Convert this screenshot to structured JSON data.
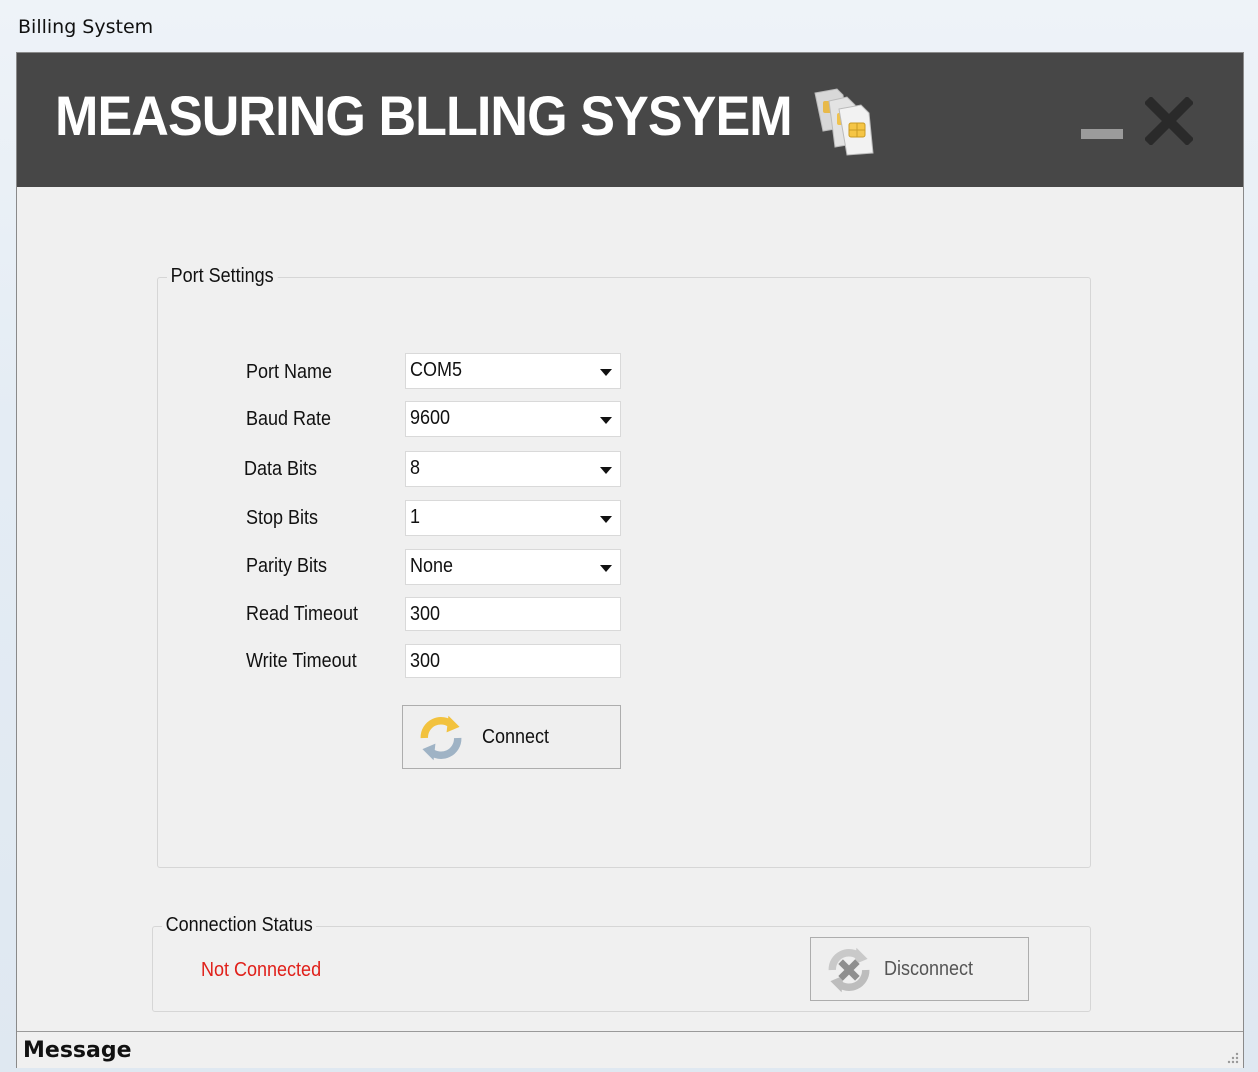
{
  "outer_window": {
    "title": "Billing System"
  },
  "header": {
    "title": "MEASURING BLLING SYSYEM",
    "icon": "sim-card-icon",
    "background": "#474747"
  },
  "port_settings": {
    "legend": "Port Settings",
    "fields": [
      {
        "label": "Port Name",
        "value": "COM5",
        "type": "dropdown"
      },
      {
        "label": "Baud Rate",
        "value": "9600",
        "type": "dropdown"
      },
      {
        "label": "Data Bits",
        "value": "8",
        "type": "dropdown"
      },
      {
        "label": "Stop Bits",
        "value": "1",
        "type": "dropdown"
      },
      {
        "label": "Parity Bits",
        "value": "None",
        "type": "dropdown"
      },
      {
        "label": "Read Timeout",
        "value": "300",
        "type": "text"
      },
      {
        "label": "Write Timeout",
        "value": "300",
        "type": "text"
      }
    ],
    "connect_label": "Connect"
  },
  "connection_status": {
    "legend": "Connection Status",
    "status": "Not Connected",
    "status_color": "#e0201a",
    "disconnect_label": "Disconnect"
  },
  "statusbar": {
    "message": "Message"
  }
}
